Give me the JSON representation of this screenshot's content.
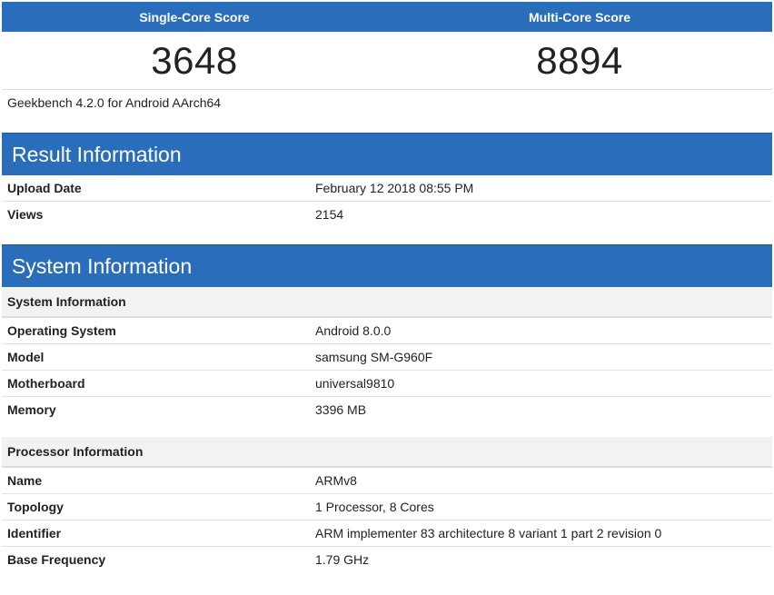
{
  "scores": {
    "single_label": "Single-Core Score",
    "multi_label": "Multi-Core Score",
    "single_value": "3648",
    "multi_value": "8894"
  },
  "version": "Geekbench 4.2.0 for Android AArch64",
  "result_info": {
    "title": "Result Information",
    "rows": [
      {
        "key": "Upload Date",
        "value": "February 12 2018 08:55 PM"
      },
      {
        "key": "Views",
        "value": "2154"
      }
    ]
  },
  "system_info": {
    "title": "System Information",
    "system_subtitle": "System Information",
    "system_rows": [
      {
        "key": "Operating System",
        "value": "Android 8.0.0"
      },
      {
        "key": "Model",
        "value": "samsung SM-G960F"
      },
      {
        "key": "Motherboard",
        "value": "universal9810"
      },
      {
        "key": "Memory",
        "value": "3396 MB"
      }
    ],
    "processor_subtitle": "Processor Information",
    "processor_rows": [
      {
        "key": "Name",
        "value": "ARMv8"
      },
      {
        "key": "Topology",
        "value": "1 Processor, 8 Cores"
      },
      {
        "key": "Identifier",
        "value": "ARM implementer 83 architecture 8 variant 1 part 2 revision 0"
      },
      {
        "key": "Base Frequency",
        "value": "1.79 GHz"
      }
    ]
  }
}
